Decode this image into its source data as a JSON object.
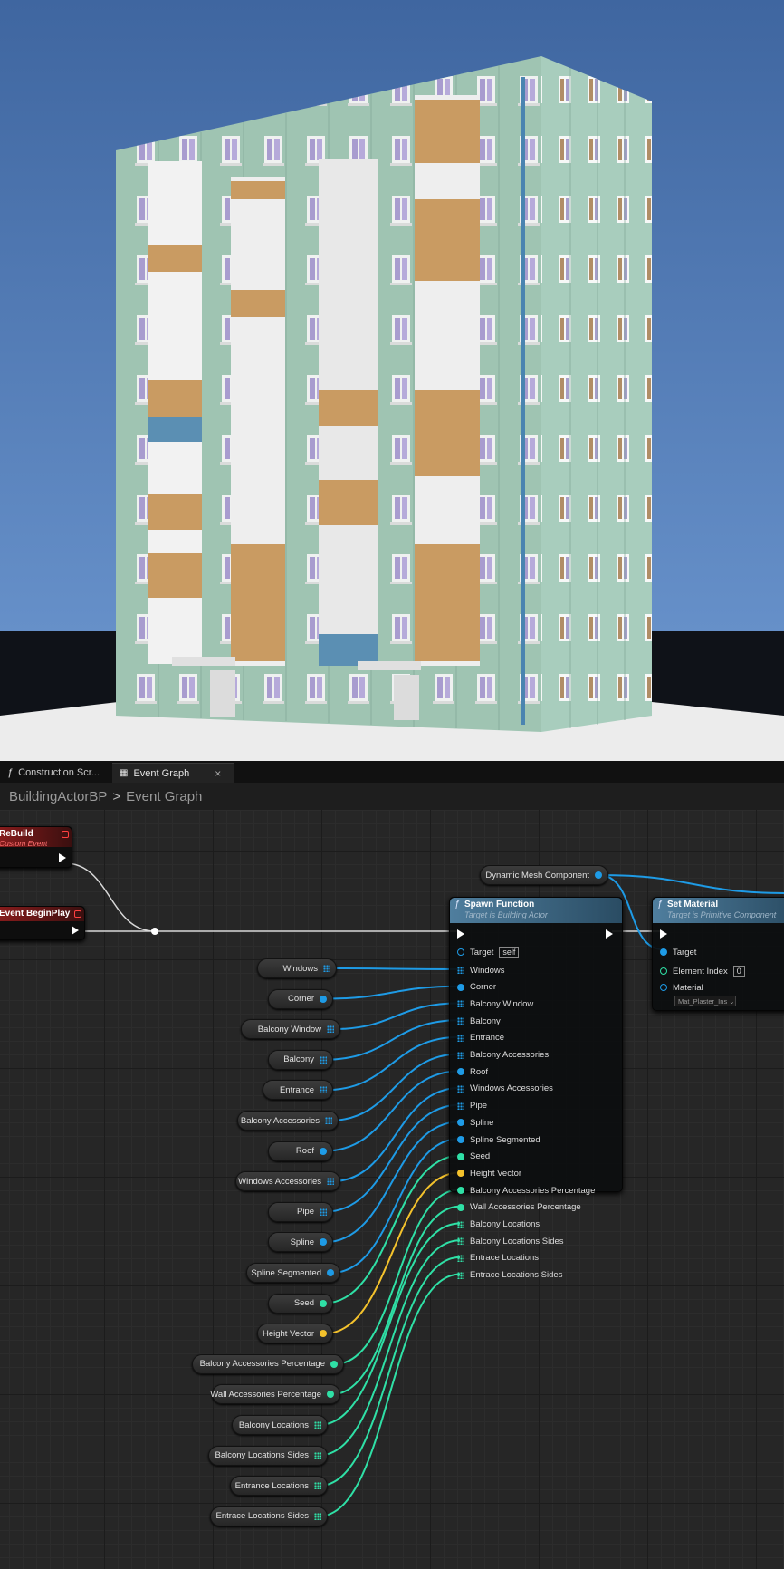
{
  "viewport": {
    "sky_top": "#3f66a0",
    "sky_bottom": "#6690c9",
    "ground": "#ebebeb",
    "horizon": "#0f1218"
  },
  "tabs": [
    {
      "label": "Construction Scr...",
      "icon": "function-icon"
    },
    {
      "label": "Event Graph",
      "icon": "graph-icon",
      "close": "×"
    }
  ],
  "breadcrumb": {
    "root": "BuildingActorBP",
    "separator": ">",
    "current": "Event Graph"
  },
  "events": [
    {
      "title": "ReBuild",
      "subtitle": "Custom Event"
    },
    {
      "title": "Event BeginPlay",
      "subtitle": ""
    }
  ],
  "dynamic_mesh": {
    "label": "Dynamic Mesh Component"
  },
  "spawn_function": {
    "title": "Spawn Function",
    "subtitle": "Target is Building Actor",
    "target_label": "Target",
    "target_value": "self",
    "inputs": [
      "Windows",
      "Corner",
      "Balcony Window",
      "Balcony",
      "Entrance",
      "Balcony Accessories",
      "Roof",
      "Windows Accessories",
      "Pipe",
      "Spline",
      "Spline Segmented",
      "Seed",
      "Height Vector",
      "Balcony Accessories Percentage",
      "Wall Accessories Percentage",
      "Balcony Locations",
      "Balcony Locations Sides",
      "Entrace Locations",
      "Entrace Locations Sides"
    ]
  },
  "set_material": {
    "title": "Set Material",
    "subtitle": "Target is Primitive Component",
    "target_label": "Target",
    "index_label": "Element Index",
    "index_value": "0",
    "material_label": "Material",
    "material_value": "Mat_Plaster_Ins"
  },
  "variables": [
    {
      "label": "Windows",
      "pin": "grid"
    },
    {
      "label": "Corner",
      "pin": "dot"
    },
    {
      "label": "Balcony Window",
      "pin": "grid"
    },
    {
      "label": "Balcony",
      "pin": "grid"
    },
    {
      "label": "Entrance",
      "pin": "grid"
    },
    {
      "label": "Balcony Accessories",
      "pin": "grid"
    },
    {
      "label": "Roof",
      "pin": "dot"
    },
    {
      "label": "Windows Accessories",
      "pin": "grid"
    },
    {
      "label": "Pipe",
      "pin": "grid"
    },
    {
      "label": "Spline",
      "pin": "dot"
    },
    {
      "label": "Spline Segmented",
      "pin": "dot"
    },
    {
      "label": "Seed",
      "pin": "dot"
    },
    {
      "label": "Height Vector",
      "pin": "dot"
    },
    {
      "label": "Balcony Accessories Percentage",
      "pin": "dot"
    },
    {
      "label": "Wall Accessories Percentage",
      "pin": "dot"
    },
    {
      "label": "Balcony Locations",
      "pin": "grid"
    },
    {
      "label": "Balcony Locations Sides",
      "pin": "grid"
    },
    {
      "label": "Entrance Locations",
      "pin": "grid"
    },
    {
      "label": "Entrace Locations Sides",
      "pin": "grid"
    }
  ],
  "pin_colors": {
    "object": "#1e9be6",
    "integer": "#2fe0a6",
    "vector": "#f4c22c",
    "exec": "#ffffff"
  }
}
